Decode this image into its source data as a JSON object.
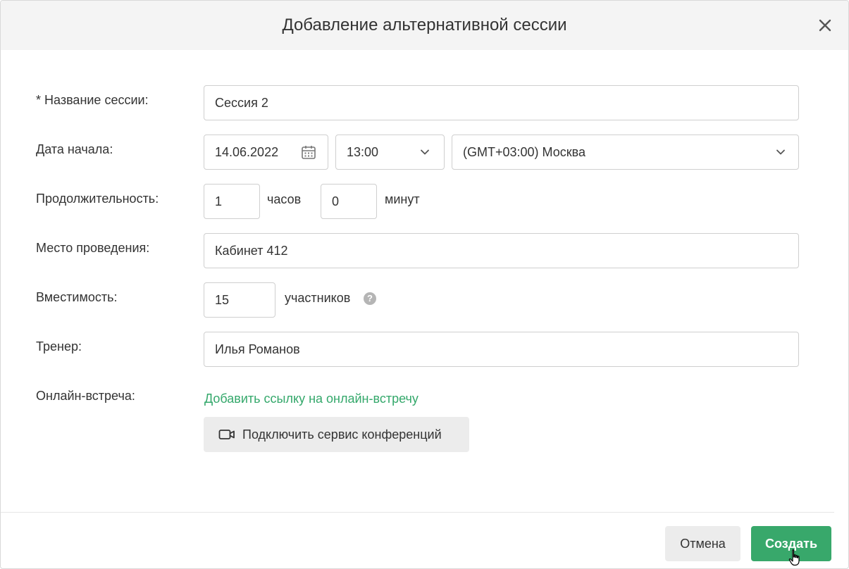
{
  "dialog": {
    "title": "Добавление альтернативной сессии"
  },
  "form": {
    "session_name": {
      "label": "* Название сессии:",
      "value": "Сессия 2"
    },
    "start_date": {
      "label": "Дата начала:",
      "date": "14.06.2022",
      "time": "13:00",
      "timezone": "(GMT+03:00) Москва"
    },
    "duration": {
      "label": "Продолжительность:",
      "hours": "1",
      "hours_unit": "часов",
      "minutes": "0",
      "minutes_unit": "минут"
    },
    "location": {
      "label": "Место проведения:",
      "value": "Кабинет 412"
    },
    "capacity": {
      "label": "Вместимость:",
      "value": "15",
      "unit": "участников",
      "help": "?"
    },
    "trainer": {
      "label": "Тренер:",
      "value": "Илья Романов"
    },
    "online": {
      "label": "Онлайн-встреча:",
      "add_link": "Добавить ссылку на онлайн-встречу",
      "connect_button": "Подключить сервис конференций"
    }
  },
  "footer": {
    "cancel_label": "Отмена",
    "create_label": "Создать"
  },
  "colors": {
    "accent": "#38a86b",
    "link": "#34a86b",
    "header_bg": "#f4f4f4",
    "secondary_button_bg": "#ececec"
  },
  "icons": {
    "close": "close-icon",
    "calendar": "calendar-icon",
    "dropdown": "chevron-down-icon",
    "help": "help-icon",
    "video": "video-camera-icon",
    "cursor": "hand-pointer-icon"
  }
}
